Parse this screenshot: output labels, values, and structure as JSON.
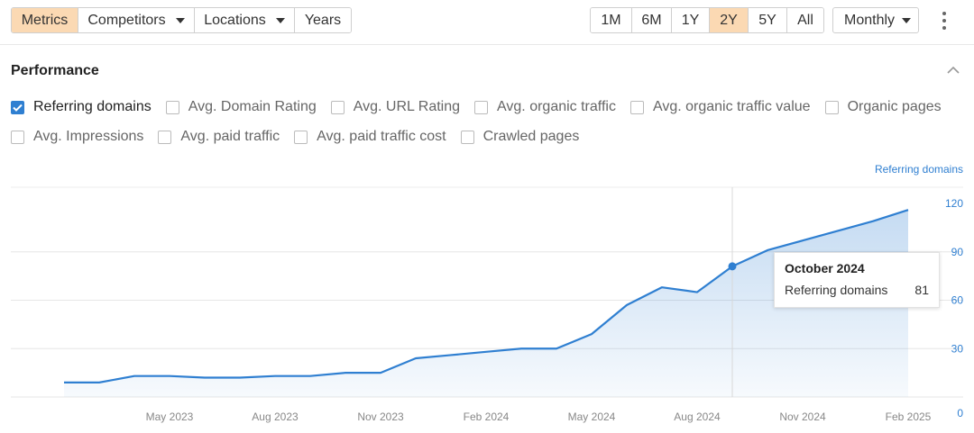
{
  "toolbar": {
    "filters": [
      "Metrics",
      "Competitors",
      "Locations",
      "Years"
    ],
    "active_filter": "Metrics",
    "ranges": [
      "1M",
      "6M",
      "1Y",
      "2Y",
      "5Y",
      "All"
    ],
    "active_range": "2Y",
    "interval": "Monthly"
  },
  "section": {
    "title": "Performance"
  },
  "metrics": [
    {
      "label": "Referring domains",
      "checked": true
    },
    {
      "label": "Avg. Domain Rating",
      "checked": false
    },
    {
      "label": "Avg. URL Rating",
      "checked": false
    },
    {
      "label": "Avg. organic traffic",
      "checked": false
    },
    {
      "label": "Avg. organic traffic value",
      "checked": false
    },
    {
      "label": "Organic pages",
      "checked": false
    },
    {
      "label": "Avg. Impressions",
      "checked": false
    },
    {
      "label": "Avg. paid traffic",
      "checked": false
    },
    {
      "label": "Avg. paid traffic cost",
      "checked": false
    },
    {
      "label": "Crawled pages",
      "checked": false
    }
  ],
  "chart_data": {
    "type": "area",
    "series_label": "Referring domains",
    "x": [
      "Feb 2023",
      "Mar 2023",
      "Apr 2023",
      "May 2023",
      "Jun 2023",
      "Jul 2023",
      "Aug 2023",
      "Sep 2023",
      "Oct 2023",
      "Nov 2023",
      "Dec 2023",
      "Jan 2024",
      "Feb 2024",
      "Mar 2024",
      "Apr 2024",
      "May 2024",
      "Jun 2024",
      "Jul 2024",
      "Aug 2024",
      "Sep 2024",
      "Oct 2024",
      "Nov 2024",
      "Dec 2024",
      "Jan 2025",
      "Feb 2025"
    ],
    "x_tick_labels": [
      "May 2023",
      "Aug 2023",
      "Nov 2023",
      "Feb 2024",
      "May 2024",
      "Aug 2024",
      "Nov 2024",
      "Feb 2025"
    ],
    "series": [
      {
        "name": "Referring domains",
        "color": "#2f7fd1",
        "values": [
          9,
          9,
          13,
          13,
          12,
          12,
          13,
          13,
          15,
          15,
          24,
          26,
          28,
          30,
          30,
          39,
          57,
          68,
          65,
          81,
          91,
          97,
          103,
          109,
          116
        ]
      }
    ],
    "y_ticks": [
      0,
      30,
      60,
      90,
      120
    ],
    "ylim": [
      0,
      120
    ],
    "hover_index": 19,
    "grid": true
  },
  "tooltip": {
    "title": "October 2024",
    "label": "Referring domains",
    "value": "81"
  }
}
